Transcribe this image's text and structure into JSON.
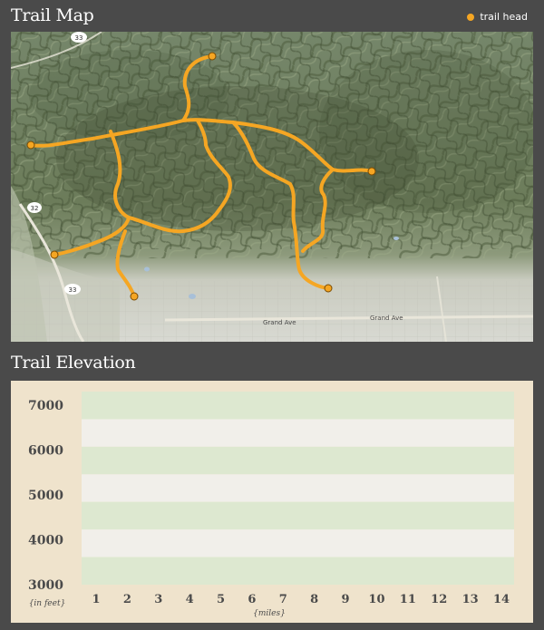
{
  "map_section": {
    "title": "Trail Map",
    "legend_label": "trail head",
    "trail_color": "#f5a623",
    "place_labels": [
      "33",
      "33",
      "Grand Ave",
      "Grand Ave"
    ]
  },
  "elevation_section": {
    "title": "Trail Elevation"
  },
  "chart_data": {
    "type": "line",
    "ylabel": "{in feet}",
    "xlabel": "{miles}",
    "ylim": [
      3000,
      7000
    ],
    "y_ticks": [
      "7000",
      "6000",
      "5000",
      "4000",
      "3000"
    ],
    "x_ticks": [
      "1",
      "2",
      "3",
      "4",
      "5",
      "6",
      "7",
      "8",
      "9",
      "10",
      "11",
      "12",
      "13",
      "14"
    ],
    "band_colors": [
      "#dde8d0",
      "#f1efea"
    ],
    "series": []
  }
}
